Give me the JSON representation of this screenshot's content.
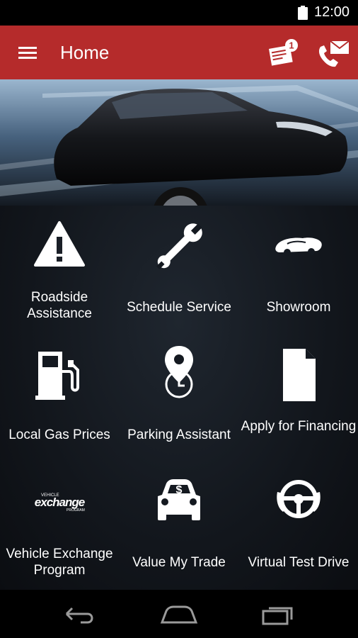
{
  "status_bar": {
    "time": "12:00"
  },
  "header": {
    "title": "Home",
    "message_badge": "1"
  },
  "tiles": [
    {
      "label": "Roadside Assistance",
      "icon": "warning-triangle-icon"
    },
    {
      "label": "Schedule Service",
      "icon": "wrench-icon"
    },
    {
      "label": "Showroom",
      "icon": "cars-icon"
    },
    {
      "label": "Local Gas Prices",
      "icon": "gas-pump-icon"
    },
    {
      "label": "Parking Assistant",
      "icon": "map-pin-clock-icon"
    },
    {
      "label": "Apply for Financing",
      "icon": "document-icon"
    },
    {
      "label": "Vehicle Exchange Program",
      "icon": "vehicle-exchange-logo",
      "logo_text": {
        "top": "VEHICLE",
        "main": "exchange",
        "bottom": "PROGRAM"
      }
    },
    {
      "label": "Value My Trade",
      "icon": "car-dollar-icon"
    },
    {
      "label": "Virtual Test Drive",
      "icon": "steering-wheel-icon"
    }
  ],
  "colors": {
    "app_bar": "#b52b2b",
    "background": "#12161c"
  }
}
